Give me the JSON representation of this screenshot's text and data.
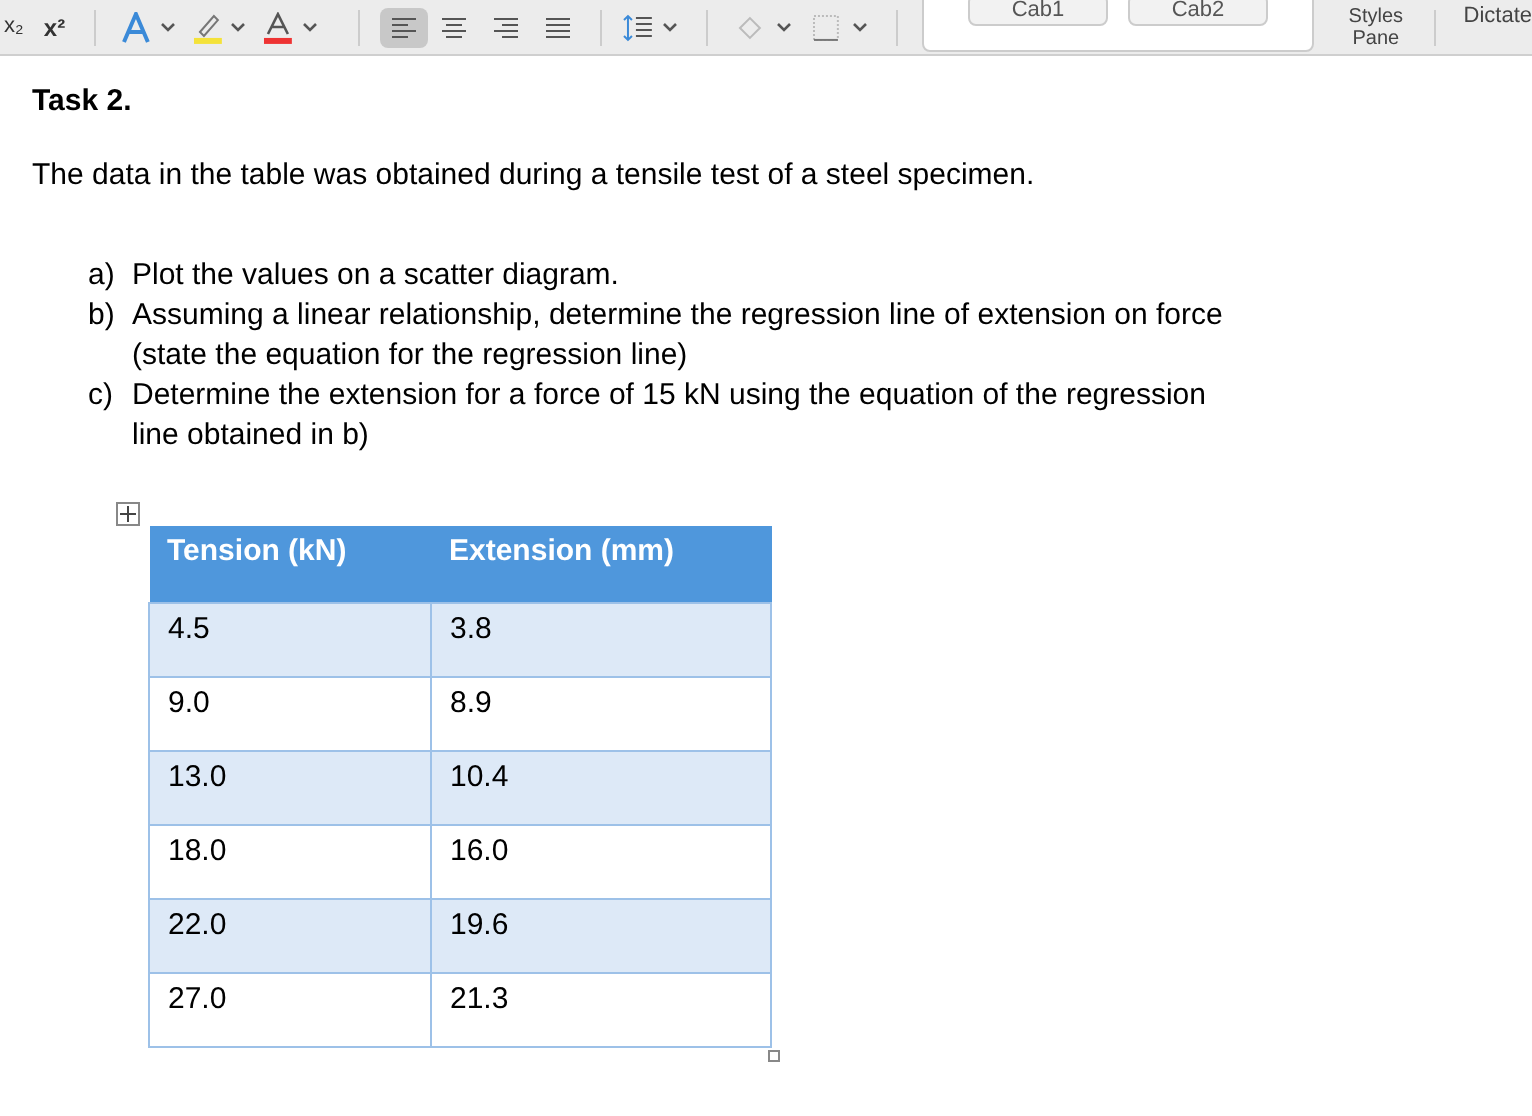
{
  "toolbar": {
    "subscript": "x₂",
    "superscript": "x²",
    "styles": [
      "Cab1",
      "Cab2"
    ],
    "styles_pane": "Styles Pane",
    "dictate": "Dictate"
  },
  "document": {
    "heading": "Task 2.",
    "intro": "The data in the table was obtained during a tensile test of a steel specimen.",
    "questions": [
      {
        "label": "a)",
        "text": "Plot the values on a scatter diagram."
      },
      {
        "label": "b)",
        "text": "Assuming a linear relationship, determine the regression line of extension on force (state the equation for the regression line)"
      },
      {
        "label": "c)",
        "text": "Determine the extension for a force of 15 kN using the equation of the regression line obtained in b)"
      }
    ],
    "table": {
      "columns": [
        "Tension (kN)",
        "Extension (mm)"
      ],
      "rows": [
        [
          "4.5",
          "3.8"
        ],
        [
          "9.0",
          "8.9"
        ],
        [
          "13.0",
          "10.4"
        ],
        [
          "18.0",
          "16.0"
        ],
        [
          "22.0",
          "19.6"
        ],
        [
          "27.0",
          "21.3"
        ]
      ]
    }
  }
}
